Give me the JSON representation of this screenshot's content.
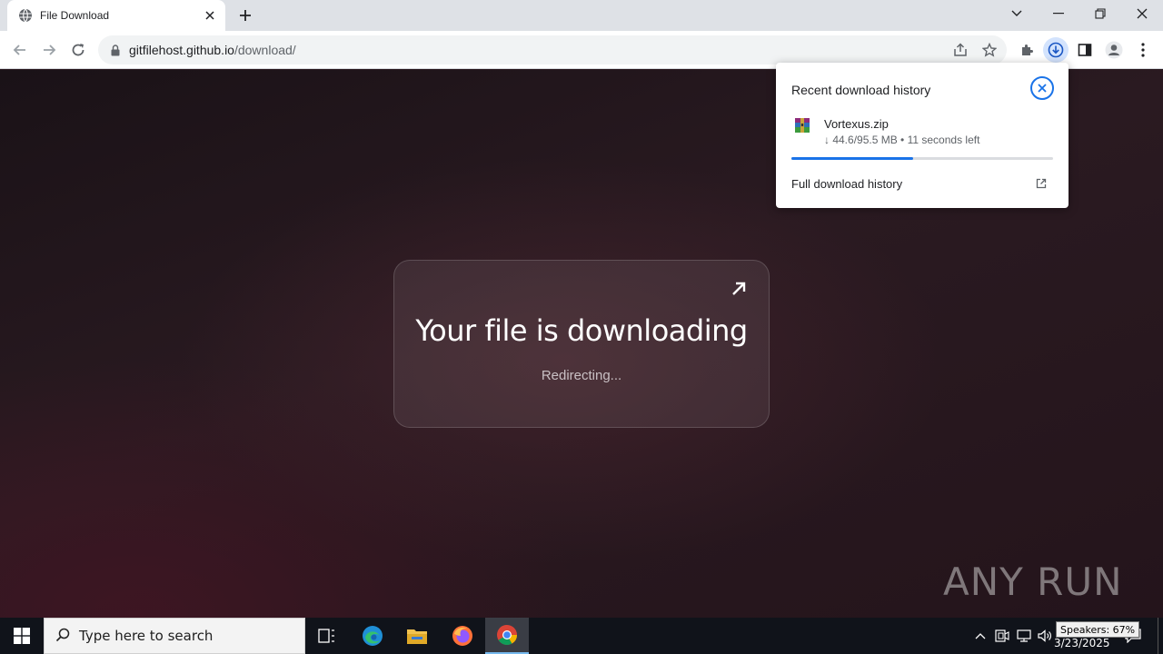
{
  "browser": {
    "tab": {
      "title": "File Download",
      "favicon": "globe-icon"
    },
    "url": {
      "host": "gitfilehost.github.io",
      "path": "/download/"
    }
  },
  "page": {
    "heading": "Your file is downloading",
    "subtext": "Redirecting...",
    "watermark": "ANY RUN"
  },
  "download_bubble": {
    "title": "Recent download history",
    "item": {
      "filename": "Vortexus.zip",
      "status": "↓ 44.6/95.5 MB • 11 seconds left",
      "progress": 0.467
    },
    "full_history_label": "Full download history",
    "accent": "#1a73e8"
  },
  "taskbar": {
    "search_placeholder": "Type here to search",
    "date": "3/23/2025",
    "tooltip": "Speakers: 67%"
  }
}
